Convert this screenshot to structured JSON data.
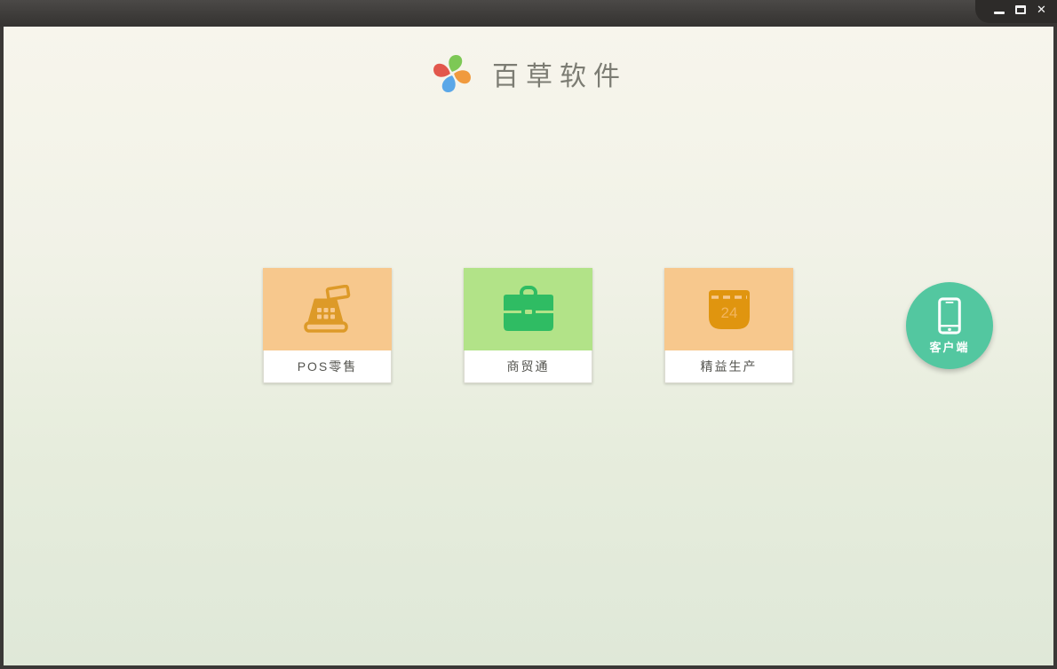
{
  "window": {
    "controls": [
      {
        "name": "minimize"
      },
      {
        "name": "maximize"
      },
      {
        "name": "close"
      }
    ]
  },
  "header": {
    "app_title": "百草软件",
    "logo_petal_colors": [
      "#7dc855",
      "#f09a3e",
      "#5aa7e8",
      "#e2574c"
    ]
  },
  "products": [
    {
      "label": "POS零售",
      "icon": "cash-register-icon",
      "bg_color": "#f7c88d",
      "icon_color": "#dd9a28"
    },
    {
      "label": "商贸通",
      "icon": "briefcase-icon",
      "bg_color": "#b2e388",
      "icon_color": "#2fbc63"
    },
    {
      "label": "精益生产",
      "icon": "calendar-icon",
      "bg_color": "#f7c88d",
      "icon_color": "#e0950f",
      "calendar_day": "24"
    }
  ],
  "client_button": {
    "label": "客户端",
    "icon": "smartphone-icon",
    "bg_color": "#53c7a0"
  },
  "colors": {
    "titlebar_top": "#4b4947",
    "titlebar_bottom": "#353331",
    "window_border": "#3a3836",
    "content_bg_top": "#f7f5ec",
    "content_bg_bottom": "#dfe8d8",
    "card_label_text": "#555550",
    "title_text": "#7c7c73"
  }
}
